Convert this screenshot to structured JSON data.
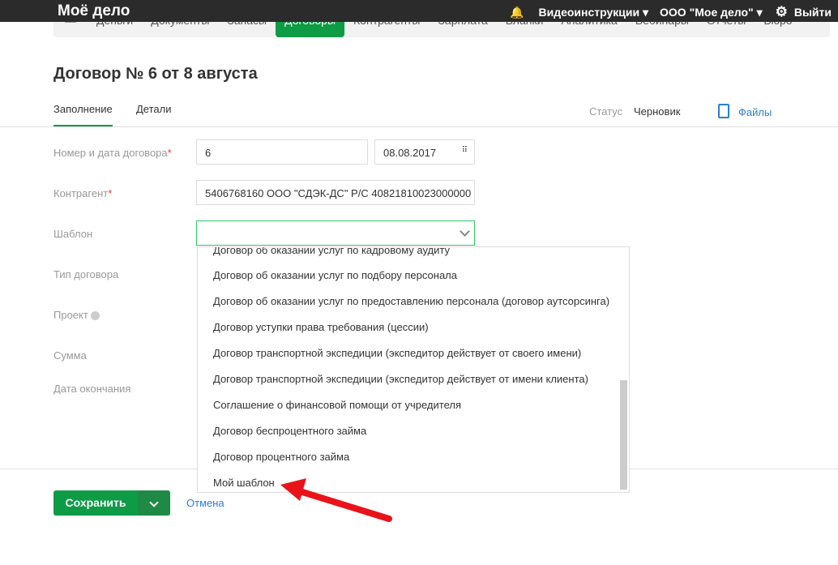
{
  "topbar": {
    "logo": "Моё дело",
    "video": "Видеоинструкции ▾",
    "org": "ООО \"Мое дело\" ▾",
    "logout": "Выйти"
  },
  "nav": [
    "Деньги",
    "Документы",
    "Запасы",
    "Договоры",
    "Контрагенты",
    "Зарплата",
    "Бланки",
    "Аналитика",
    "Вебинары",
    "Отчеты",
    "Бюро"
  ],
  "page": {
    "title": "Договор № 6 от 8 августа",
    "tab_fill": "Заполнение",
    "tab_details": "Детали",
    "status_label": "Статус",
    "status_value": "Черновик",
    "files": "Файлы"
  },
  "form": {
    "number_label": "Номер и дата договора",
    "number": "6",
    "date": "08.08.2017",
    "counterparty_label": "Контрагент",
    "counterparty": "5406768160 ООО \"СДЭК-ДС\" Р/С 40821810023000000",
    "template_label": "Шаблон",
    "type_label": "Тип договора",
    "project_label": "Проект",
    "sum_label": "Сумма",
    "end_label": "Дата окончания",
    "req": "*"
  },
  "dropdown": [
    "Договор об оказании услуг по кадровому аудиту",
    "Договор об оказании услуг по подбору персонала",
    "Договор об оказании услуг по предоставлению персонала (договор аутсорсинга)",
    "Договор уступки права требования (цессии)",
    "Договор транспортной экспедиции (экспедитор действует от своего имени)",
    "Договор транспортной экспедиции (экспедитор действует от имени клиента)",
    "Соглашение о финансовой помощи от учредителя",
    "Договор беспроцентного займа",
    "Договор процентного займа",
    "Мой шаблон"
  ],
  "actions": {
    "save": "Сохранить",
    "cancel": "Отмена"
  }
}
